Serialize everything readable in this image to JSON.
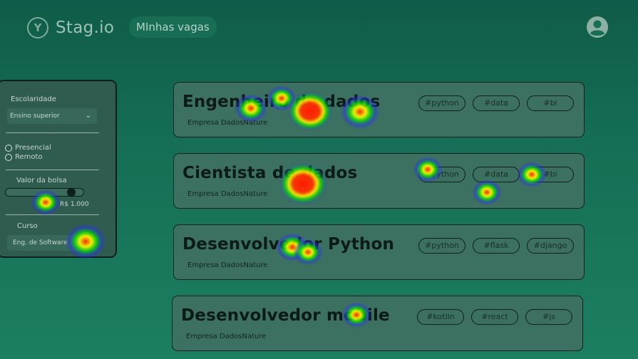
{
  "header": {
    "brand": "Stag.io",
    "brand_icon": "branch-logo-icon",
    "nav_label": "MInhas vagas",
    "profile_icon": "user-avatar-icon"
  },
  "filters": {
    "education_label": "Escolaridade",
    "education_value": "Ensino superior",
    "modality_options": [
      "Presencial",
      "Remoto"
    ],
    "stipend_label": "Valor da bolsa",
    "stipend_value": "R$ 1.000",
    "stipend_fraction": 0.88,
    "course_label": "Curso",
    "course_value": "Eng. de Software"
  },
  "jobs": [
    {
      "title": "Engenheiro de dados",
      "company": "Empresa DadosNature",
      "tags": [
        "#python",
        "#data",
        "#bi"
      ]
    },
    {
      "title": "Cientista de dados",
      "company": "Empresa DadosNature",
      "tags": [
        "#python",
        "#data",
        "#bi"
      ]
    },
    {
      "title": "Desenvolvedor Python",
      "company": "Empresa DadosNature",
      "tags": [
        "#python",
        "#flask",
        "#django"
      ]
    },
    {
      "title": "Desenvolvedor mobile",
      "company": "Empresa DadosNature",
      "tags": [
        "#kotlin",
        "#react",
        "#js"
      ]
    }
  ],
  "colors": {
    "background": "#156e55",
    "card": "#3c7060",
    "outline": "#0c1f18",
    "heat_hot": "#ff2a00",
    "heat_warm": "#ffff00",
    "heat_cool": "#00e000",
    "heat_cold": "#2b2bff"
  }
}
